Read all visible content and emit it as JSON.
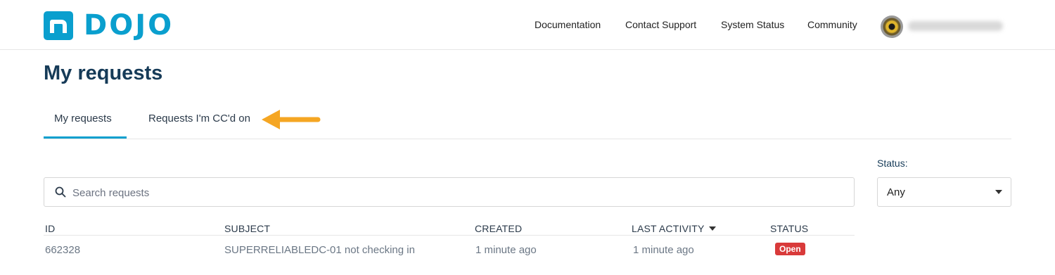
{
  "header": {
    "logo_text": "DOJO",
    "nav": [
      "Documentation",
      "Contact Support",
      "System Status",
      "Community"
    ]
  },
  "page": {
    "title": "My requests"
  },
  "tabs": [
    {
      "label": "My requests",
      "active": true
    },
    {
      "label": "Requests I'm CC'd on",
      "active": false
    }
  ],
  "filters": {
    "status_label": "Status:",
    "status_value": "Any"
  },
  "search": {
    "placeholder": "Search requests",
    "value": ""
  },
  "table": {
    "columns": [
      "ID",
      "SUBJECT",
      "CREATED",
      "LAST ACTIVITY",
      "STATUS"
    ],
    "rows": [
      {
        "id": "662328",
        "subject": "SUPERRELIABLEDC-01 not checking in",
        "created": "1 minute ago",
        "last_activity": "1 minute ago",
        "status": "Open"
      }
    ]
  },
  "colors": {
    "brand": "#0a9fce",
    "title": "#163b58",
    "arrow": "#f5a623",
    "status_open": "#d93a3a"
  }
}
